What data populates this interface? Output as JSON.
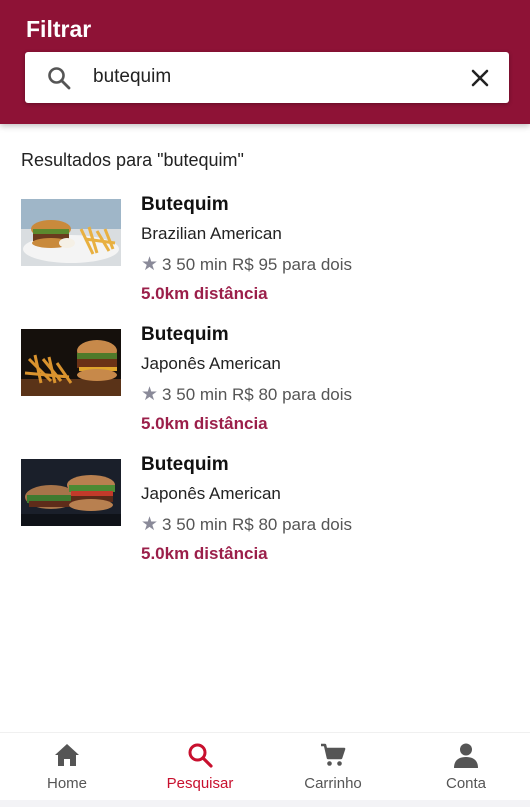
{
  "header": {
    "title": "Filtrar"
  },
  "search": {
    "value": "butequim",
    "icon": "search-icon",
    "clear_icon": "close-icon"
  },
  "results": {
    "heading": "Resultados para \"butequim\"",
    "items": [
      {
        "name": "Butequim",
        "cuisine": "Brazilian American",
        "rating": "3",
        "time": "50 min",
        "price": "R$ 95 para dois",
        "distance": "5.0km distância"
      },
      {
        "name": "Butequim",
        "cuisine": "Japonês American",
        "rating": "3",
        "time": "50 min",
        "price": "R$ 80 para dois",
        "distance": "5.0km distância"
      },
      {
        "name": "Butequim",
        "cuisine": "Japonês American",
        "rating": "3",
        "time": "50 min",
        "price": "R$ 80 para dois",
        "distance": "5.0km distância"
      }
    ]
  },
  "nav": {
    "items": [
      {
        "label": "Home",
        "icon": "home-icon"
      },
      {
        "label": "Pesquisar",
        "icon": "search-icon",
        "active": true
      },
      {
        "label": "Carrinho",
        "icon": "cart-icon"
      },
      {
        "label": "Conta",
        "icon": "account-icon"
      }
    ]
  },
  "colors": {
    "brand": "#8e1236",
    "accent_text": "#9b1f4a",
    "active_nav": "#c8102e"
  }
}
